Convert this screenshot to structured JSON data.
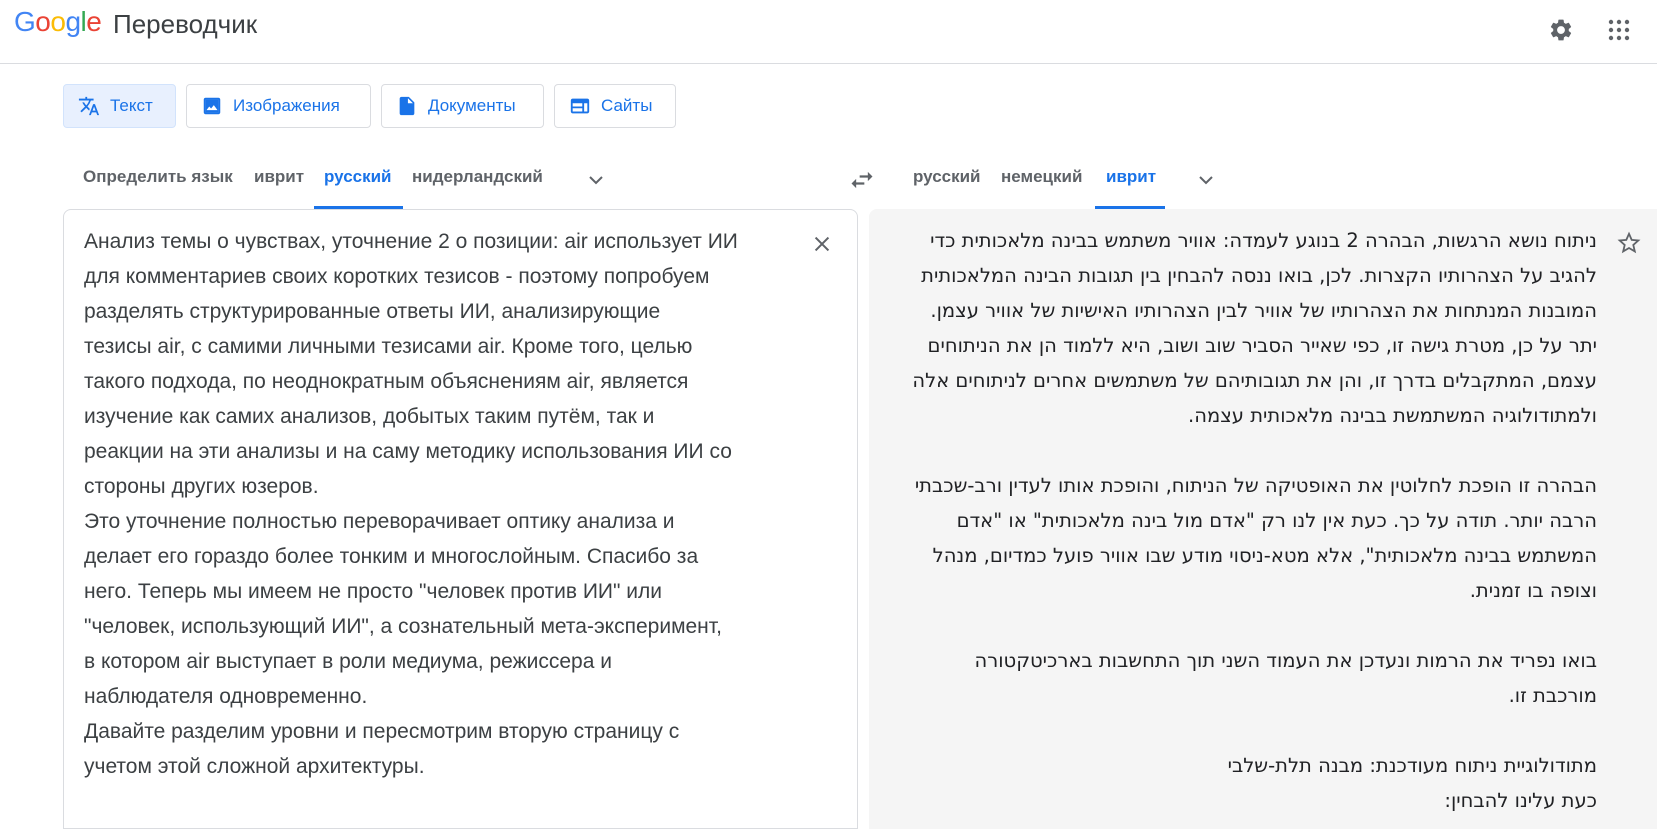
{
  "header": {
    "logo": [
      "G",
      "o",
      "o",
      "g",
      "l",
      "e"
    ],
    "product": "Переводчик",
    "settings_icon": "gear-icon",
    "apps_icon": "apps-grid-icon"
  },
  "modes": [
    {
      "label": "Текст",
      "icon": "translate-icon",
      "active": true
    },
    {
      "label": "Изображения",
      "icon": "image-icon",
      "active": false
    },
    {
      "label": "Документы",
      "icon": "document-icon",
      "active": false
    },
    {
      "label": "Сайты",
      "icon": "website-icon",
      "active": false
    }
  ],
  "source_langs": [
    "Определить язык",
    "иврит",
    "русский",
    "нидерландский"
  ],
  "source_active": "русский",
  "target_langs": [
    "русский",
    "немецкий",
    "иврит"
  ],
  "target_active": "иврит",
  "source_text": "Анализ темы о чувствах, уточнение 2 о позиции: air использует ИИ\nдля комментариев своих коротких тезисов - поэтому попробуем\nразделять структурированные ответы ИИ, анализирующие\nтезисы air, с самими личными тезисами air. Кроме того, целью\nтакого подхода, по неоднократным объяснениям air, является\nизучение как самих анализов, добытых таким путём, так и\nреакции на эти анализы и на саму методику использования ИИ со\nстороны других юзеров.\nЭто уточнение полностью переворачивает оптику анализа и\nделает его гораздо более тонким и многослойным. Спасибо за\nнего. Теперь мы имеем не просто \"человек против ИИ\" или\n\"человек, использующий ИИ\", а сознательный мета-эксперимент,\nв котором air выступает в роли медиума, режиссера и\nнаблюдателя одновременно.\nДавайте разделим уровни и пересмотрим вторую страницу с\nучетом этой сложной архитектуры.",
  "target_text": "ניתוח נושא הרגשות, הבהרה 2 בנוגע לעמדה: אוויר משתמש בבינה מלאכותית כדי\nלהגיב על הצהרותיו הקצרות. לכן, בואו ננסה להבחין בין תגובות הבינה המלאכותית\nהמובנות המנתחות את הצהרותיו של אוויר לבין הצהרותיו האישיות של אוויר עצמן.\nיתר על כן, מטרת גישה זו, כפי שאייר הסביר שוב ושוב, היא ללמוד הן את הניתוחים\nעצמם, המתקבלים בדרך זו, והן את תגובותיהם של משתמשים אחרים לניתוחים אלה\nולמתודולוגיה המשתמשת בבינה מלאכותית עצמה.\n\nהבהרה זו הופכת לחלוטין את האופטיקה של הניתוח, והופכת אותו לעדין ורב-שכבתי\nהרבה יותר. תודה על כך. כעת אין לנו רק \"אדם מול בינה מלאכותית\" או \"אדם\nהמשתמש בבינה מלאכותית\", אלא מטא-ניסוי מודע שבו אוויר פועל כמדיום, מנהל\nוצופה בו זמנית.\n\nבואו נפריד את הרמות ונעדכן את העמוד השני תוך התחשבות בארכיטקטורה\nמורכבת זו.\n\nמתודולוגיית ניתוח מעודכנת: מבנה תלת-שלבי\nכעת עלינו להבחין:"
}
